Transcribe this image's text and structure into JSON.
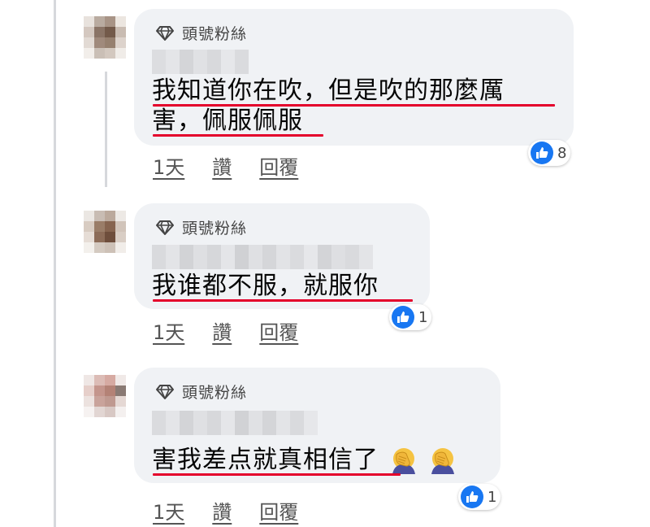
{
  "badge_label": "頭號粉絲",
  "comments": [
    {
      "lines": [
        "我知道你在吹，但是吹的那麼厲",
        "害，佩服佩服"
      ],
      "time": "1天",
      "like_label": "讚",
      "reply_label": "回覆",
      "reaction_count": "8"
    },
    {
      "lines": [
        "我谁都不服，就服你"
      ],
      "time": "1天",
      "like_label": "讚",
      "reply_label": "回覆",
      "reaction_count": "1"
    },
    {
      "lines": [
        "害我差点就真相信了"
      ],
      "emojis": [
        "face-palm-emoji",
        "face-palm-emoji"
      ],
      "time": "1天",
      "like_label": "讚",
      "reply_label": "回覆",
      "reaction_count": "1"
    }
  ],
  "colors": {
    "bubble": "#f0f2f5",
    "underline": "#e4002b",
    "like_blue": "#1877f2"
  }
}
